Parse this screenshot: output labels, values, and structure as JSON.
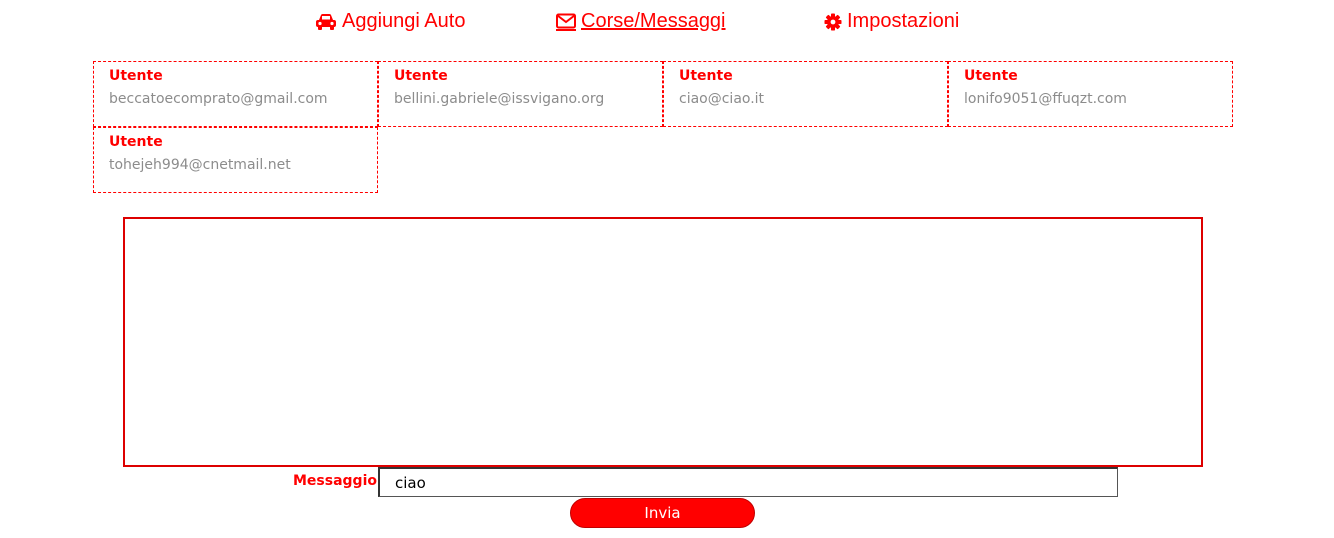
{
  "nav": {
    "add_car": {
      "label": "Aggiungi Auto",
      "icon": "car-icon"
    },
    "rides_messages": {
      "label": "Corse/Messaggi",
      "icon": "envelope-icon",
      "active": true
    },
    "settings": {
      "label": "Impostazioni",
      "icon": "gear-icon"
    }
  },
  "users": [
    {
      "title": "Utente",
      "email": "beccatoecomprato@gmail.com"
    },
    {
      "title": "Utente",
      "email": "bellini.gabriele@issvigano.org"
    },
    {
      "title": "Utente",
      "email": "ciao@ciao.it"
    },
    {
      "title": "Utente",
      "email": "lonifo9051@ffuqzt.com"
    },
    {
      "title": "Utente",
      "email": "tohejeh994@cnetmail.net"
    }
  ],
  "message_form": {
    "label": "Messaggio:",
    "value": "ciao",
    "send_label": "Invia"
  },
  "colors": {
    "accent": "#ff0000",
    "email_text": "#8c8c8c"
  }
}
